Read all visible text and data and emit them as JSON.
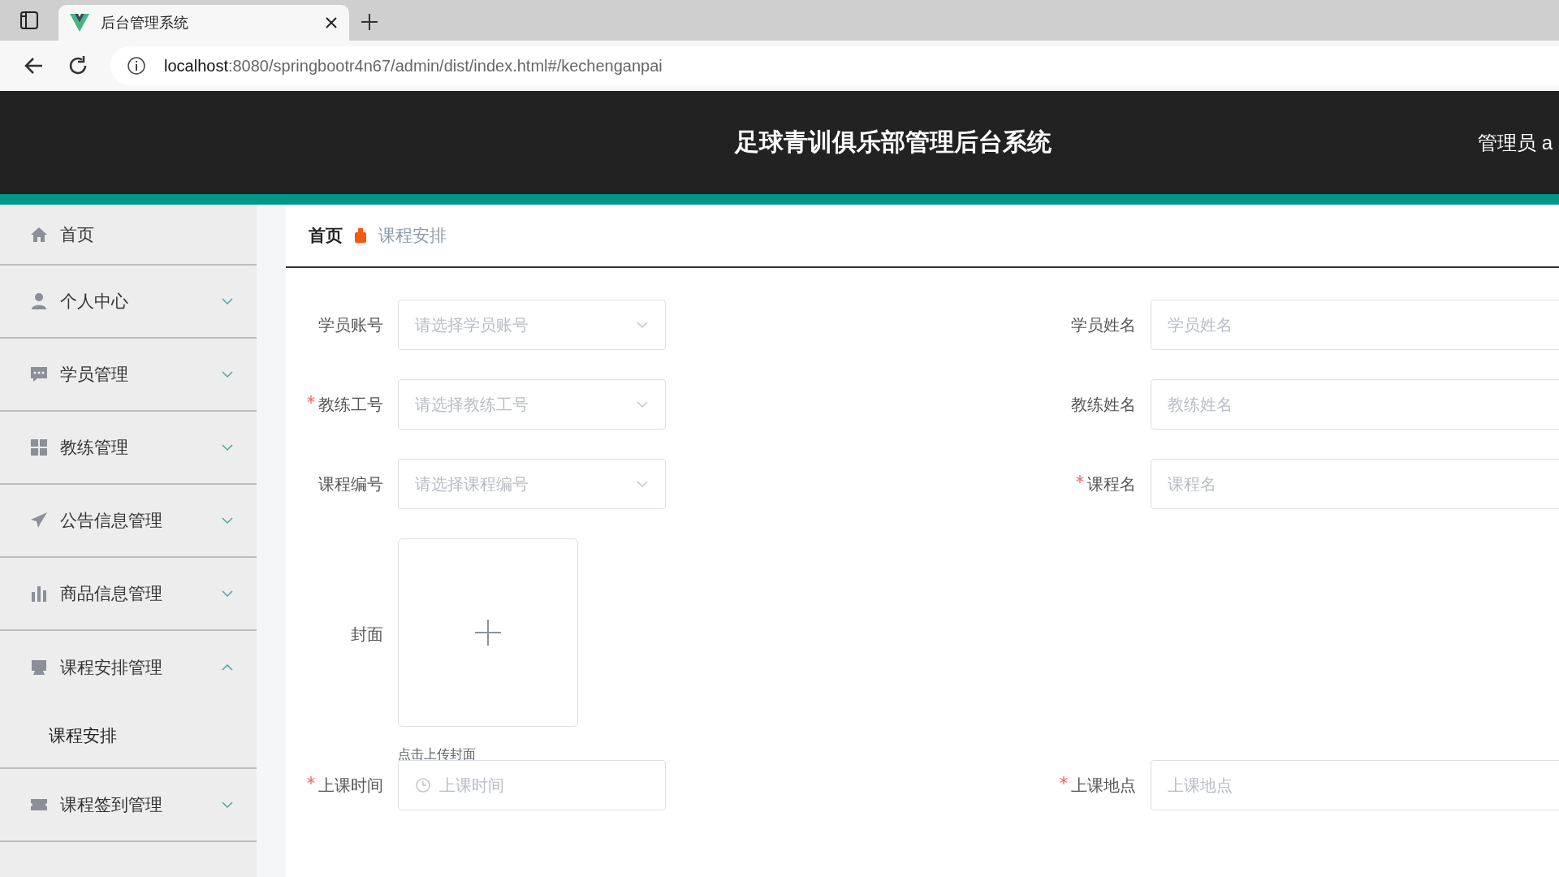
{
  "browser": {
    "tab_title": "后台管理系统",
    "url_host": "localhost",
    "url_path": ":8080/springbootr4n67/admin/dist/index.html#/kechenganpai"
  },
  "header": {
    "title": "足球青训俱乐部管理后台系统",
    "user": "管理员 a"
  },
  "sidebar": {
    "items": [
      {
        "label": "首页",
        "kind": "link"
      },
      {
        "label": "个人中心",
        "kind": "menu",
        "expanded": false
      },
      {
        "label": "学员管理",
        "kind": "menu",
        "expanded": false
      },
      {
        "label": "教练管理",
        "kind": "menu",
        "expanded": false
      },
      {
        "label": "公告信息管理",
        "kind": "menu",
        "expanded": false
      },
      {
        "label": "商品信息管理",
        "kind": "menu",
        "expanded": false
      },
      {
        "label": "课程安排管理",
        "kind": "menu",
        "expanded": true,
        "children": [
          {
            "label": "课程安排"
          }
        ]
      },
      {
        "label": "课程签到管理",
        "kind": "menu",
        "expanded": false
      }
    ]
  },
  "breadcrumb": {
    "home": "首页",
    "current": "课程安排"
  },
  "form": {
    "rows": [
      {
        "left": {
          "label": "学员账号",
          "required": false,
          "kind": "select",
          "placeholder": "请选择学员账号"
        },
        "right": {
          "label": "学员姓名",
          "required": false,
          "kind": "text",
          "placeholder": "学员姓名"
        }
      },
      {
        "left": {
          "label": "教练工号",
          "required": true,
          "kind": "select",
          "placeholder": "请选择教练工号"
        },
        "right": {
          "label": "教练姓名",
          "required": false,
          "kind": "text",
          "placeholder": "教练姓名"
        }
      },
      {
        "left": {
          "label": "课程编号",
          "required": false,
          "kind": "select",
          "placeholder": "请选择课程编号"
        },
        "right": {
          "label": "课程名",
          "required": true,
          "kind": "text",
          "placeholder": "课程名"
        }
      },
      {
        "left": {
          "label": "封面",
          "required": false,
          "kind": "upload",
          "hint": "点击上传封面"
        }
      },
      {
        "left": {
          "label": "上课时间",
          "required": true,
          "kind": "time",
          "placeholder": "上课时间"
        },
        "right": {
          "label": "上课地点",
          "required": true,
          "kind": "text",
          "placeholder": "上课地点"
        }
      }
    ]
  }
}
